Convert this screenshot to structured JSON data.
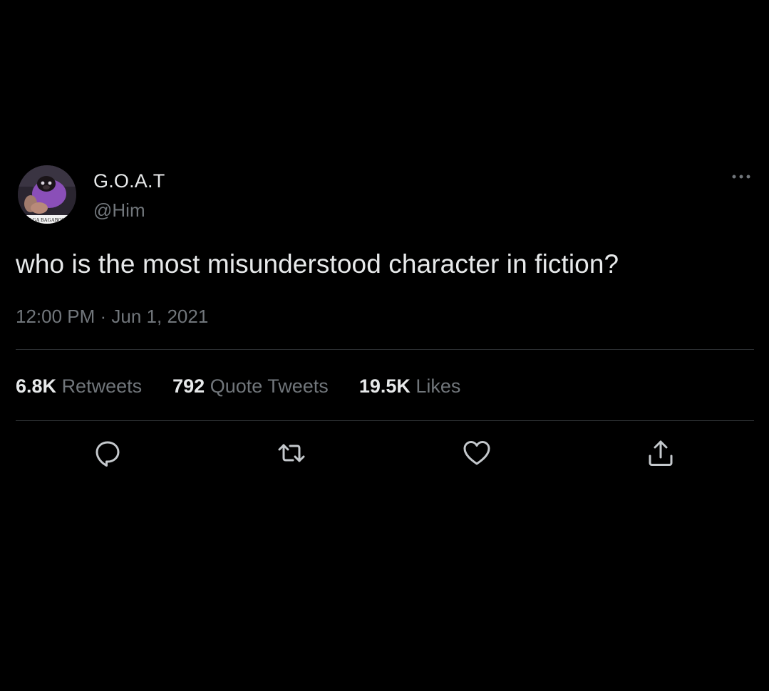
{
  "tweet": {
    "author": {
      "display_name": "G.O.A.T",
      "handle": "@Him",
      "avatar_caption": "AGA BAGABOO"
    },
    "text": "who is the most misunderstood character in fiction?",
    "timestamp": "12:00 PM · Jun 1, 2021",
    "stats": [
      {
        "count": "6.8K",
        "label": "Retweets"
      },
      {
        "count": "792",
        "label": "Quote Tweets"
      },
      {
        "count": "19.5K",
        "label": "Likes"
      }
    ],
    "actions": [
      {
        "icon": "reply-icon"
      },
      {
        "icon": "retweet-icon"
      },
      {
        "icon": "like-icon"
      },
      {
        "icon": "share-icon"
      }
    ]
  },
  "colors": {
    "background": "#000000",
    "primary_text": "#e7e9ea",
    "secondary_text": "#71767b",
    "divider": "#2f3336"
  }
}
